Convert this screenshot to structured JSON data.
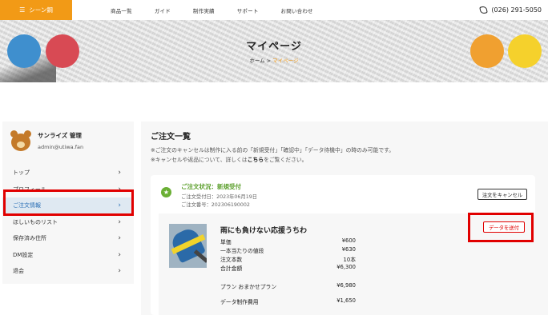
{
  "header": {
    "brand": "シーン鋼",
    "nav": [
      "商品一覧",
      "ガイド",
      "制作実績",
      "サポート",
      "お問い合わせ"
    ],
    "phone": "(026) 291-5050"
  },
  "hero": {
    "title": "マイページ",
    "breadcrumb": [
      "ホーム",
      "マイページ"
    ],
    "accent_color": "#f29a16"
  },
  "sidebar": {
    "user_name": "サンライズ 管理",
    "user_email": "admin@utiwa.fan",
    "items": [
      {
        "label": "トップ"
      },
      {
        "label": "プロフィール"
      },
      {
        "label": "ご注文情報",
        "active": true
      },
      {
        "label": "ほしいものリスト"
      },
      {
        "label": "保存済み住所"
      },
      {
        "label": "DM設定"
      },
      {
        "label": "退会"
      }
    ]
  },
  "main": {
    "title": "ご注文一覧",
    "note1": "※ご注文のキャンセルは制作に入る前の「新規受付」「確認中」「データ待機中」の時のみ可能です。",
    "note2_pre": "※キャンセルや返品について、詳しくは",
    "note2_link": "こちら",
    "note2_post": "をご覧ください。",
    "order": {
      "status": "ご注文状況：新規受付",
      "date": "ご注文受付日：2023年06月19日",
      "number": "ご注文番号：202306190002",
      "cancel_label": "注文をキャンセル",
      "send_label": "データを送付",
      "product_name": "雨にも負けない応援うちわ",
      "rows": [
        {
          "label": "単価",
          "value": "¥600"
        },
        {
          "label": "一本当たりの値段",
          "value": "¥630"
        },
        {
          "label": "注文本数",
          "value": "10本"
        },
        {
          "label": "合計金額",
          "value": "¥6,300"
        },
        {
          "label": "プラン おまかせプラン",
          "value": "¥6,980"
        },
        {
          "label": "データ制作費用",
          "value": "¥1,650"
        }
      ]
    }
  },
  "annotation_color": "#e10000"
}
